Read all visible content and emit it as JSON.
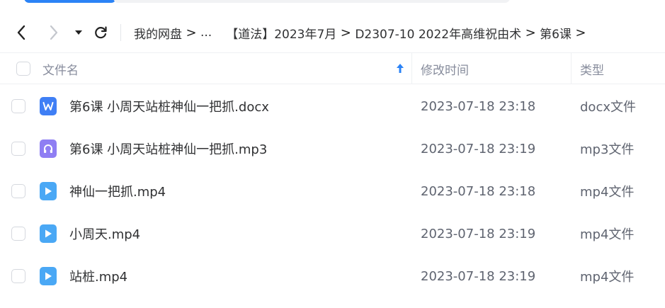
{
  "nav": {
    "breadcrumb": [
      "我的网盘",
      "...",
      "【道法】2023年7月",
      "D2307-10 2022年高维祝由术",
      "第6课"
    ],
    "separator": ">"
  },
  "header": {
    "col_name": "文件名",
    "col_modified": "修改时间",
    "col_type": "类型",
    "sort_column": "文件名",
    "sort_direction": "ascending"
  },
  "files": [
    {
      "name": "第6课  小周天站桩神仙一把抓.docx",
      "modified": "2023-07-18 23:18",
      "type": "docx文件",
      "icon": "word-doc-icon"
    },
    {
      "name": "第6课 小周天站桩神仙一把抓.mp3",
      "modified": "2023-07-18 23:19",
      "type": "mp3文件",
      "icon": "audio-headphones-icon"
    },
    {
      "name": "神仙一把抓.mp4",
      "modified": "2023-07-18 23:18",
      "type": "mp4文件",
      "icon": "video-play-icon"
    },
    {
      "name": "小周天.mp4",
      "modified": "2023-07-18 23:19",
      "type": "mp4文件",
      "icon": "video-play-icon"
    },
    {
      "name": "站桩.mp4",
      "modified": "2023-07-18 23:19",
      "type": "mp4文件",
      "icon": "video-play-icon"
    }
  ],
  "colors": {
    "accent": "#2b83f6",
    "word_icon": "#3f7ff5",
    "audio_icon": "#8f7ef3",
    "video_icon": "#4aa8f5",
    "text_primary": "#303133",
    "text_secondary": "#878c9c"
  }
}
